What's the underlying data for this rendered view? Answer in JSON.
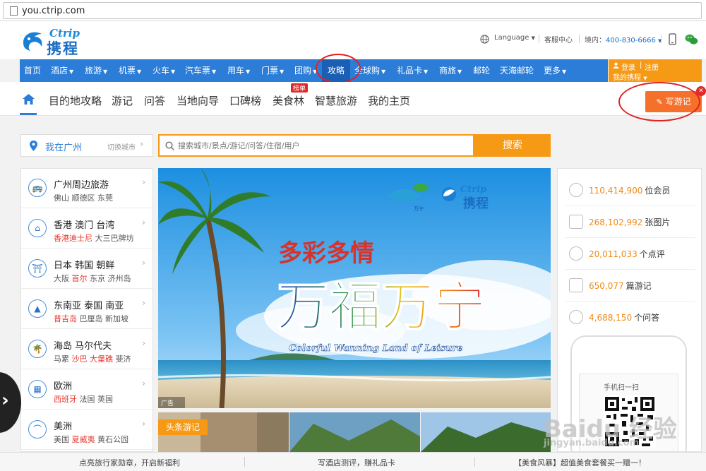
{
  "browser": {
    "url": "you.ctrip.com"
  },
  "header": {
    "logo_en": "Ctrip",
    "logo_cn": "携程",
    "language": "Language",
    "service": "客服中心",
    "phone_label": "境内：",
    "phone": "400-830-6666"
  },
  "nav": {
    "items": [
      "首页",
      "酒店",
      "旅游",
      "机票",
      "火车",
      "汽车票",
      "用车",
      "门票",
      "团购",
      "攻略",
      "全球购",
      "礼品卡",
      "商旅",
      "邮轮",
      "天海邮轮",
      "更多"
    ],
    "login": "登录",
    "register": "注册",
    "my_ctrip": "我的携程"
  },
  "subnav": {
    "items": [
      "目的地攻略",
      "游记",
      "问答",
      "当地向导",
      "口碑榜",
      "美食林",
      "智慧旅游",
      "我的主页"
    ],
    "badge": "榜单",
    "write_button": "写游记"
  },
  "location": {
    "current": "我在广州",
    "switch": "切换城市"
  },
  "search": {
    "placeholder": "搜索城市/景点/游记/问答/住宿/用户",
    "button": "搜索"
  },
  "categories": [
    {
      "title": "广州周边旅游",
      "subs": [
        {
          "t": "佛山",
          "hot": false
        },
        {
          "t": "顺德区",
          "hot": false
        },
        {
          "t": "东莞",
          "hot": false
        }
      ]
    },
    {
      "title": "香港 澳门 台湾",
      "subs": [
        {
          "t": "香港迪士尼",
          "hot": true
        },
        {
          "t": "大三巴牌坊",
          "hot": false
        }
      ]
    },
    {
      "title": "日本 韩国 朝鲜",
      "subs": [
        {
          "t": "大阪",
          "hot": false
        },
        {
          "t": "首尔",
          "hot": true
        },
        {
          "t": "东京",
          "hot": false
        },
        {
          "t": "济州岛",
          "hot": false
        }
      ]
    },
    {
      "title": "东南亚 泰国 南亚",
      "subs": [
        {
          "t": "普吉岛",
          "hot": true
        },
        {
          "t": "巴厘岛",
          "hot": false
        },
        {
          "t": "新加坡",
          "hot": false
        }
      ]
    },
    {
      "title": "海岛 马尔代夫",
      "subs": [
        {
          "t": "马累",
          "hot": false
        },
        {
          "t": "沙巴",
          "hot": true
        },
        {
          "t": "大堡礁",
          "hot": true
        },
        {
          "t": "斐济",
          "hot": false
        }
      ]
    },
    {
      "title": "欧洲",
      "subs": [
        {
          "t": "西班牙",
          "hot": true
        },
        {
          "t": "法国",
          "hot": false
        },
        {
          "t": "英国",
          "hot": false
        }
      ]
    },
    {
      "title": "美洲",
      "subs": [
        {
          "t": "美国",
          "hot": false
        },
        {
          "t": "夏威夷",
          "hot": true
        },
        {
          "t": "黄石公园",
          "hot": false
        }
      ]
    }
  ],
  "banner": {
    "title": "多彩多情",
    "subtitle": "万福万宁",
    "english": "Colorful Wanning Land of Leisure",
    "ad_label": "广告",
    "partner_logo": "万宁"
  },
  "headline_label": "头条游记",
  "stats": [
    {
      "num": "110,414,900",
      "label": "位会员"
    },
    {
      "num": "268,102,992",
      "label": "张图片"
    },
    {
      "num": "20,011,033",
      "label": "个点评"
    },
    {
      "num": "650,077",
      "label": "篇游记"
    },
    {
      "num": "4,688,150",
      "label": "个问答"
    }
  ],
  "qr": {
    "label": "手机扫一扫"
  },
  "bottom_bar": [
    "点亮旅行家勋章，开启新福利",
    "写酒店测评，赚礼品卡",
    "【美食风暴】超值美食套餐买一赠一！"
  ],
  "watermark": {
    "line1": "Baidu 经验",
    "line2": "jingyan.baidu.com"
  },
  "colors": {
    "nav_blue": "#2b7dd8",
    "orange": "#f69a16",
    "write_orange": "#f5702a",
    "hot_red": "#e8352b"
  }
}
